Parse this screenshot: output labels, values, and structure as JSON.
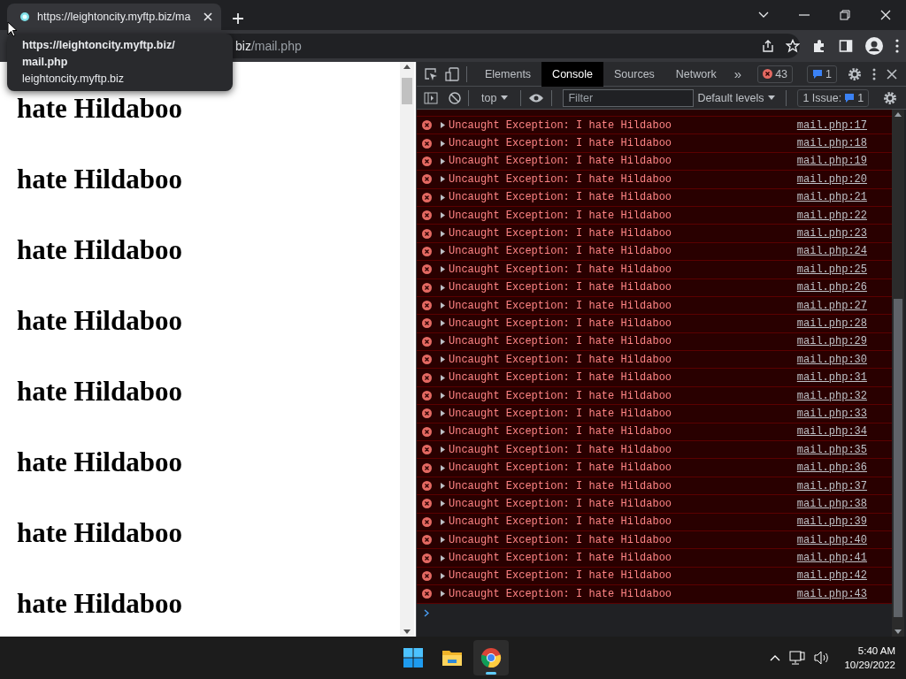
{
  "browser_tabs": [
    {
      "title": "https://leightoncity.myftp.biz/ma",
      "selected": true
    }
  ],
  "tab_tooltip": {
    "title": "https://leightoncity.myftp.biz/mail.php",
    "host": "leightoncity.myftp.biz"
  },
  "address": {
    "host_tail": "biz",
    "path": "/mail.php"
  },
  "page": {
    "headings": [
      "hate Hildaboo",
      "hate Hildaboo",
      "hate Hildaboo",
      "hate Hildaboo",
      "hate Hildaboo",
      "hate Hildaboo",
      "hate Hildaboo",
      "hate Hildaboo"
    ]
  },
  "devtools": {
    "tabs": [
      {
        "label": "Elements",
        "selected": false
      },
      {
        "label": "Console",
        "selected": true
      },
      {
        "label": "Sources",
        "selected": false
      },
      {
        "label": "Network",
        "selected": false
      }
    ],
    "more": "»",
    "error_count": "43",
    "message_count": "1",
    "context": "top",
    "filter": {
      "placeholder": "Filter"
    },
    "levels": "Default levels",
    "issues": {
      "label": "1 Issue:",
      "count": "1"
    },
    "messages": [
      {
        "kind": "error",
        "text": "Uncaught Exception: I hate Hildaboo",
        "source": "mail.php:17"
      },
      {
        "kind": "error",
        "text": "Uncaught Exception: I hate Hildaboo",
        "source": "mail.php:18"
      },
      {
        "kind": "error",
        "text": "Uncaught Exception: I hate Hildaboo",
        "source": "mail.php:19"
      },
      {
        "kind": "error",
        "text": "Uncaught Exception: I hate Hildaboo",
        "source": "mail.php:20"
      },
      {
        "kind": "error",
        "text": "Uncaught Exception: I hate Hildaboo",
        "source": "mail.php:21"
      },
      {
        "kind": "error",
        "text": "Uncaught Exception: I hate Hildaboo",
        "source": "mail.php:22"
      },
      {
        "kind": "error",
        "text": "Uncaught Exception: I hate Hildaboo",
        "source": "mail.php:23"
      },
      {
        "kind": "error",
        "text": "Uncaught Exception: I hate Hildaboo",
        "source": "mail.php:24"
      },
      {
        "kind": "error",
        "text": "Uncaught Exception: I hate Hildaboo",
        "source": "mail.php:25"
      },
      {
        "kind": "error",
        "text": "Uncaught Exception: I hate Hildaboo",
        "source": "mail.php:26"
      },
      {
        "kind": "error",
        "text": "Uncaught Exception: I hate Hildaboo",
        "source": "mail.php:27"
      },
      {
        "kind": "error",
        "text": "Uncaught Exception: I hate Hildaboo",
        "source": "mail.php:28"
      },
      {
        "kind": "error",
        "text": "Uncaught Exception: I hate Hildaboo",
        "source": "mail.php:29"
      },
      {
        "kind": "error",
        "text": "Uncaught Exception: I hate Hildaboo",
        "source": "mail.php:30"
      },
      {
        "kind": "error",
        "text": "Uncaught Exception: I hate Hildaboo",
        "source": "mail.php:31"
      },
      {
        "kind": "error",
        "text": "Uncaught Exception: I hate Hildaboo",
        "source": "mail.php:32"
      },
      {
        "kind": "error",
        "text": "Uncaught Exception: I hate Hildaboo",
        "source": "mail.php:33"
      },
      {
        "kind": "error",
        "text": "Uncaught Exception: I hate Hildaboo",
        "source": "mail.php:34"
      },
      {
        "kind": "error",
        "text": "Uncaught Exception: I hate Hildaboo",
        "source": "mail.php:35"
      },
      {
        "kind": "error",
        "text": "Uncaught Exception: I hate Hildaboo",
        "source": "mail.php:36"
      },
      {
        "kind": "error",
        "text": "Uncaught Exception: I hate Hildaboo",
        "source": "mail.php:37"
      },
      {
        "kind": "error",
        "text": "Uncaught Exception: I hate Hildaboo",
        "source": "mail.php:38"
      },
      {
        "kind": "error",
        "text": "Uncaught Exception: I hate Hildaboo",
        "source": "mail.php:39"
      },
      {
        "kind": "error",
        "text": "Uncaught Exception: I hate Hildaboo",
        "source": "mail.php:40"
      },
      {
        "kind": "error",
        "text": "Uncaught Exception: I hate Hildaboo",
        "source": "mail.php:41"
      },
      {
        "kind": "error",
        "text": "Uncaught Exception: I hate Hildaboo",
        "source": "mail.php:42"
      },
      {
        "kind": "error",
        "text": "Uncaught Exception: I hate Hildaboo",
        "source": "mail.php:43"
      }
    ]
  },
  "taskbar": {
    "apps": [
      {
        "kind": "start",
        "selected": false
      },
      {
        "kind": "folder",
        "selected": false
      },
      {
        "kind": "chrome",
        "selected": true
      }
    ],
    "time": "5:40 AM",
    "date": "10/29/2022"
  }
}
